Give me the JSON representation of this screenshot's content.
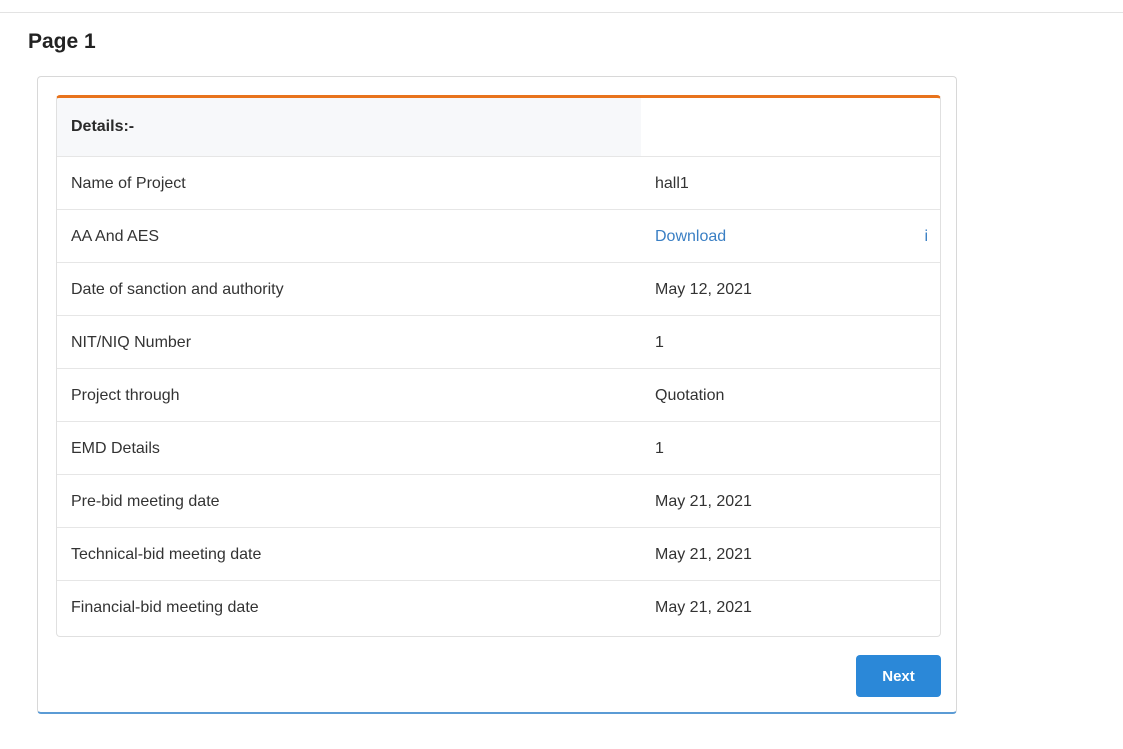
{
  "page": {
    "title": "Page 1"
  },
  "details": {
    "header": "Details:-",
    "rows": [
      {
        "label": "Name of Project",
        "value": "hall1"
      },
      {
        "label": "AA And AES",
        "value": "Download",
        "icon_text": "i"
      },
      {
        "label": "Date of sanction and authority",
        "value": "May 12, 2021"
      },
      {
        "label": "NIT/NIQ Number",
        "value": "1"
      },
      {
        "label": "Project through",
        "value": "Quotation"
      },
      {
        "label": "EMD Details",
        "value": "1"
      },
      {
        "label": "Pre-bid meeting date",
        "value": "May 21, 2021"
      },
      {
        "label": "Technical-bid meeting date",
        "value": "May 21, 2021"
      },
      {
        "label": "Financial-bid meeting date",
        "value": "May 21, 2021"
      }
    ]
  },
  "actions": {
    "next_label": "Next"
  },
  "colors": {
    "accent_orange": "#e8731c",
    "link_blue": "#3a7fc4",
    "button_blue": "#2b88d8",
    "panel_bottom_blue": "#5b9bd5"
  },
  "icons": {
    "info": "info-icon"
  }
}
